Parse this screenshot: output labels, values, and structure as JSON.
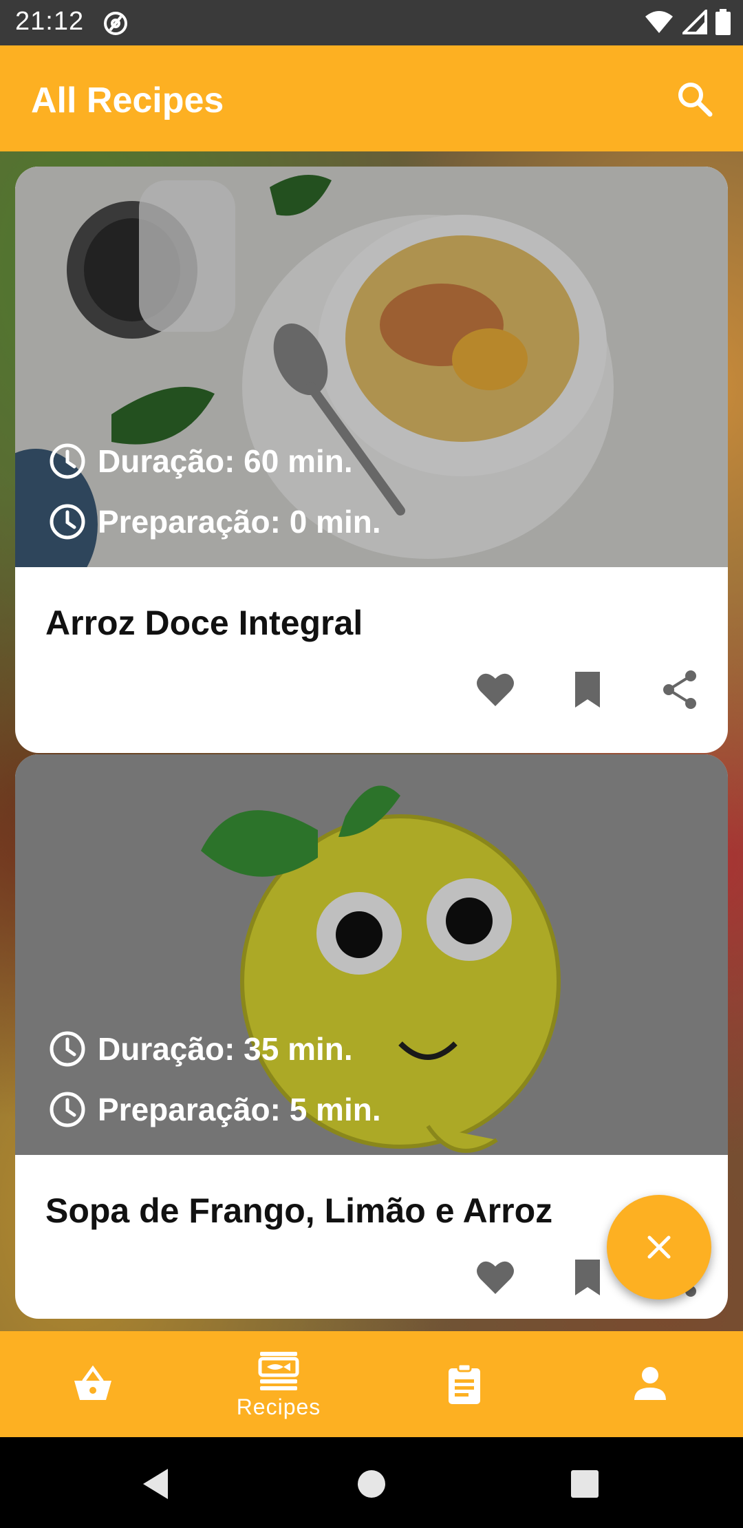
{
  "status_bar": {
    "time": "21:12"
  },
  "app_bar": {
    "title": "All Recipes"
  },
  "recipes": [
    {
      "title": "Arroz Doce Integral",
      "duration": "Duração: 60 min.",
      "preparation": "Preparação: 0 min."
    },
    {
      "title": "Sopa de Frango, Limão e Arroz",
      "duration": "Duração: 35 min.",
      "preparation": "Preparação: 5 min."
    }
  ],
  "bottom_nav": {
    "items": [
      {
        "label": "",
        "icon": "basket-icon"
      },
      {
        "label": "Recipes",
        "icon": "recipes-icon"
      },
      {
        "label": "",
        "icon": "clipboard-icon"
      },
      {
        "label": "",
        "icon": "person-icon"
      }
    ]
  },
  "colors": {
    "accent": "#FDB022",
    "status_bar": "#3a3a3a"
  }
}
